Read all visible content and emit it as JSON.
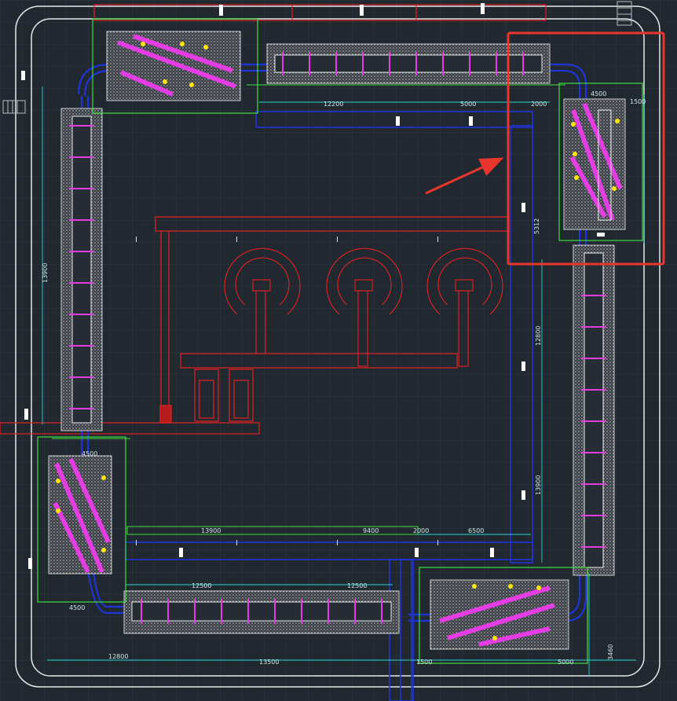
{
  "drawing": {
    "background_color": "#212830",
    "colors": {
      "grid": "#2c3540",
      "outline": "#e8e8e8",
      "blue": "#1f34d6",
      "green": "#3ee03e",
      "red": "#e52222",
      "cyan": "#29d3d3",
      "magenta": "#e33de3",
      "yellow": "#ffe600",
      "highlight_box": "#e8362c",
      "arrow": "#e8362c"
    },
    "dimensions": {
      "top_12200": "12200",
      "top_5000": "5000",
      "top_2000": "2000",
      "top_right_4500": "4500",
      "top_right_1500": "1500",
      "right_12800": "12800",
      "right_13900": "13900",
      "right_5312": "5312",
      "left_13900": "13900",
      "left_12500": "12500",
      "left_4500": "4500",
      "bottom_13900": "13900",
      "bottom_9400": "9400",
      "bottom_2000": "2000",
      "bottom_6500": "6500",
      "bottom_12500a": "12500",
      "bottom_12500b": "12500",
      "bottom_12800": "12800",
      "bottom_13500": "13500",
      "bottom_4500": "4500",
      "bottom_3460": "3460",
      "bottom_5000": "5000",
      "bottom_1500": "1500"
    },
    "callout": {
      "description": "Red rectangle highlighting the top-right turn station with a red arrow pointing to it"
    }
  }
}
